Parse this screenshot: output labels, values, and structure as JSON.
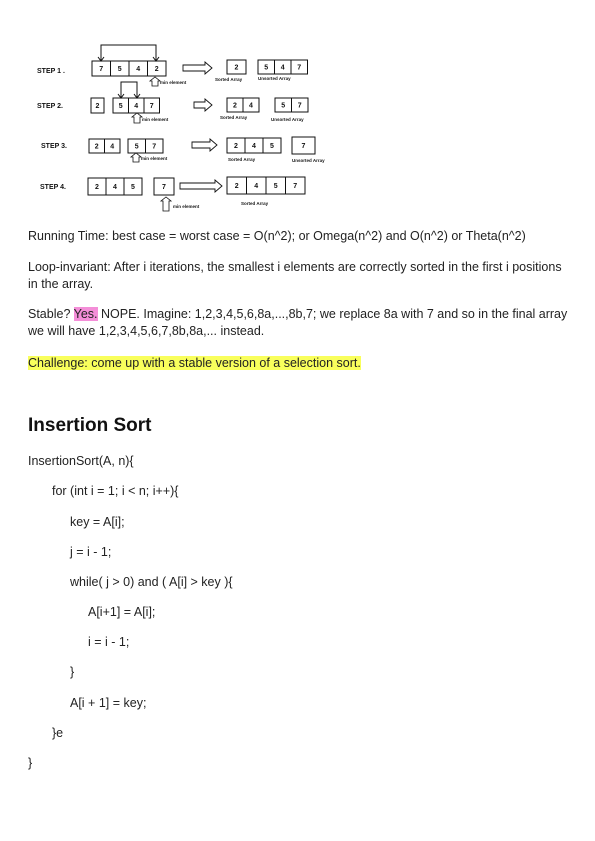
{
  "figure": {
    "steps": [
      {
        "label": "STEP 1 .",
        "left_cells": [
          "7",
          "5",
          "4",
          "2"
        ],
        "min_label": "min element",
        "sorted": [
          "2"
        ],
        "unsorted": [
          "5",
          "4",
          "7"
        ],
        "sorted_label": "Sorted Array",
        "unsorted_label": "Unsorted Array"
      },
      {
        "label": "STEP 2.",
        "left_cells": [
          "2",
          "5",
          "4",
          "7"
        ],
        "min_label": "min element",
        "sorted": [
          "2",
          "4"
        ],
        "unsorted": [
          "5",
          "7"
        ],
        "sorted_label": "Sorted Array",
        "unsorted_label": "Unsorted Array"
      },
      {
        "label": "STEP 3.",
        "left_cells": [
          "2",
          "4",
          "5",
          "7"
        ],
        "min_label": "min element",
        "sorted": [
          "2",
          "4",
          "5"
        ],
        "unsorted": [
          "7"
        ],
        "sorted_label": "Sorted Array",
        "unsorted_label": "Unsorted Array"
      },
      {
        "label": "STEP 4.",
        "left_cells": [
          "2",
          "4",
          "5",
          "7"
        ],
        "min_label": "min element",
        "sorted": [
          "2",
          "4",
          "5",
          "7"
        ],
        "unsorted": [],
        "sorted_label": "Sorted Array",
        "unsorted_label": ""
      }
    ]
  },
  "running_time": "Running Time: best case = worst case = O(n^2); or Omega(n^2) and O(n^2) or Theta(n^2)",
  "loop_invariant": "Loop-invariant: After i iterations, the smallest i elements are correctly sorted in the first i positions in the array.",
  "stable": {
    "prefix": "Stable? ",
    "highlight": "Yes.",
    "rest": " NOPE. Imagine: 1,2,3,4,5,6,8a,...,8b,7; we replace 8a with 7 and so in the final array we will have 1,2,3,4,5,6,7,8b,8a,... instead."
  },
  "challenge": "Challenge: come up with a stable version of a selection sort.",
  "insertion": {
    "title": "Insertion Sort",
    "code": [
      "InsertionSort(A, n){",
      "for (int i = 1; i < n; i++){",
      "key = A[i];",
      "j = i - 1;",
      "while( j > 0) and ( A[i] > key ){",
      "A[i+1] = A[i];",
      "i = i - 1;",
      "}",
      "A[i + 1] = key;",
      "}e",
      "}"
    ]
  }
}
